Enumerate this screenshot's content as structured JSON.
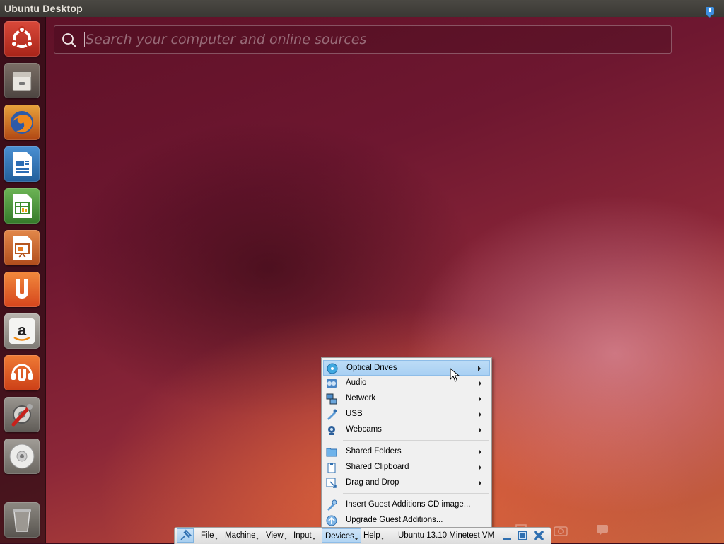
{
  "top_panel": {
    "title": "Ubuntu Desktop",
    "indicator_icon": "notification-icon"
  },
  "launcher": {
    "items": [
      {
        "name": "dash-home",
        "icon": "ubuntu-logo-icon"
      },
      {
        "name": "files",
        "icon": "file-cabinet-icon"
      },
      {
        "name": "firefox",
        "icon": "firefox-icon"
      },
      {
        "name": "libreoffice-writer",
        "icon": "writer-icon"
      },
      {
        "name": "libreoffice-calc",
        "icon": "calc-icon"
      },
      {
        "name": "libreoffice-impress",
        "icon": "impress-icon"
      },
      {
        "name": "ubuntu-one",
        "icon": "ubuntu-one-icon"
      },
      {
        "name": "amazon",
        "icon": "amazon-icon"
      },
      {
        "name": "ubuntu-one-music",
        "icon": "music-store-icon"
      },
      {
        "name": "system-settings",
        "icon": "settings-icon"
      },
      {
        "name": "dvd",
        "icon": "dvd-icon"
      },
      {
        "name": "trash",
        "icon": "trash-icon"
      }
    ]
  },
  "search": {
    "placeholder": "Search your computer and online sources",
    "value": ""
  },
  "devices_menu": {
    "items": [
      {
        "label": "Optical Drives",
        "icon": "optical-drive-icon",
        "submenu": true,
        "highlighted": true
      },
      {
        "label": "Audio",
        "icon": "audio-icon",
        "submenu": true
      },
      {
        "label": "Network",
        "icon": "network-icon",
        "submenu": true
      },
      {
        "label": "USB",
        "icon": "usb-icon",
        "submenu": true
      },
      {
        "label": "Webcams",
        "icon": "webcam-icon",
        "submenu": true
      },
      {
        "label": "Shared Folders",
        "icon": "shared-folder-icon",
        "submenu": true
      },
      {
        "label": "Shared Clipboard",
        "icon": "clipboard-icon",
        "submenu": true
      },
      {
        "label": "Drag and Drop",
        "icon": "drag-drop-icon",
        "submenu": true
      },
      {
        "label": "Insert Guest Additions CD image...",
        "icon": "guest-additions-cd-icon",
        "submenu": false
      },
      {
        "label": "Upgrade Guest Additions...",
        "icon": "upgrade-icon",
        "submenu": false
      }
    ]
  },
  "vbox_toolbar": {
    "menus": [
      "File",
      "Machine",
      "View",
      "Input",
      "Devices",
      "Help"
    ],
    "active_menu": "Devices",
    "vm_title": "Ubuntu 13.10 Minetest VM",
    "controls": [
      "minimize-icon",
      "restore-icon",
      "close-icon"
    ]
  },
  "colors": {
    "menu_highlight": "#a9d0f3",
    "launcher_bg": "#2d0c14",
    "panel_bg": "#3a3834"
  }
}
